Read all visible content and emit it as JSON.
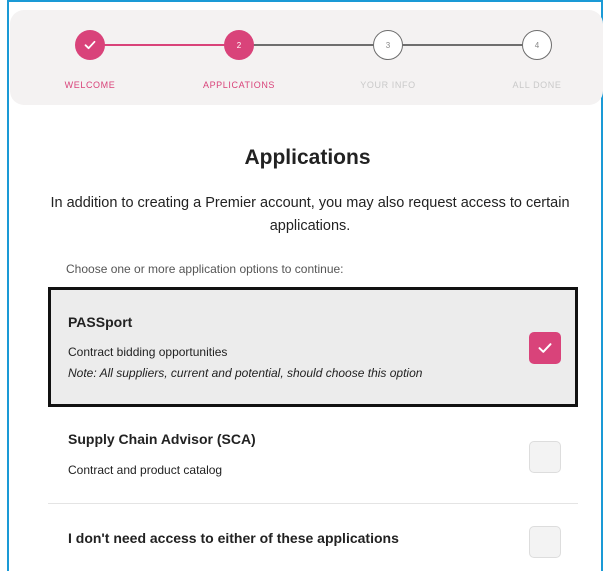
{
  "stepper": {
    "steps": [
      {
        "number": "",
        "label": "WELCOME",
        "state": "completed"
      },
      {
        "number": "2",
        "label": "APPLICATIONS",
        "state": "current"
      },
      {
        "number": "3",
        "label": "YOUR INFO",
        "state": "upcoming"
      },
      {
        "number": "4",
        "label": "ALL DONE",
        "state": "upcoming"
      }
    ]
  },
  "page": {
    "title": "Applications",
    "intro": "In addition to creating a Premier account, you may also request access to certain applications.",
    "hint": "Choose one or more application options to continue:"
  },
  "options": [
    {
      "title": "PASSport",
      "description": "Contract bidding opportunities",
      "note": "Note: All suppliers, current and potential, should choose this option",
      "checked": true
    },
    {
      "title": "Supply Chain Advisor (SCA)",
      "description": "Contract and product catalog",
      "checked": false
    },
    {
      "title": "I don't need access to either of these applications",
      "checked": false
    }
  ],
  "colors": {
    "accent": "#d9437a",
    "frame": "#1a9ad6",
    "stepper_bg": "#f4f2f2"
  }
}
